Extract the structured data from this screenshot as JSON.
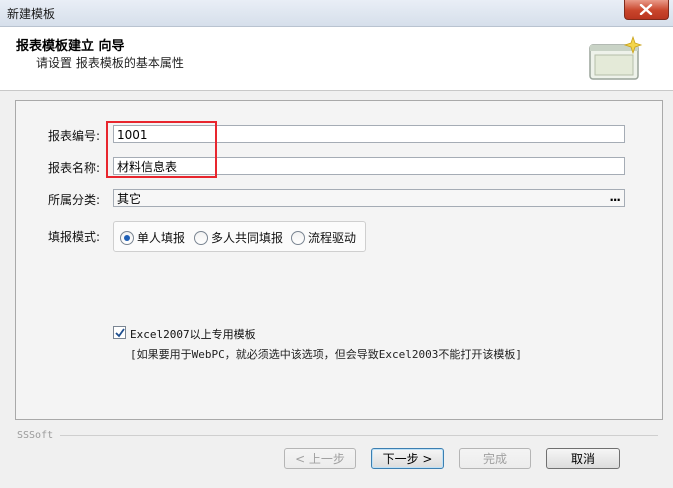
{
  "window": {
    "title": "新建模板"
  },
  "header": {
    "title": "报表模板建立 向导",
    "subtitle": "请设置 报表模板的基本属性"
  },
  "form": {
    "code": {
      "label": "报表编号:",
      "value": "1001"
    },
    "name": {
      "label": "报表名称:",
      "value": "材料信息表"
    },
    "category": {
      "label": "所属分类:",
      "value": "其它",
      "browse": "..."
    },
    "mode": {
      "label": "填报模式:",
      "options": [
        {
          "label": "单人填报",
          "selected": true
        },
        {
          "label": "多人共同填报",
          "selected": false
        },
        {
          "label": "流程驱动",
          "selected": false
        }
      ]
    },
    "excel_option": {
      "checked": true,
      "label": "Excel2007以上专用模板",
      "note": "[如果要用于WebPC，就必须选中该选项，但会导致Excel2003不能打开该模板]"
    }
  },
  "footer": {
    "brand": "SSSoft"
  },
  "buttons": {
    "prev": "< 上一步",
    "next": "下一步 >",
    "finish": "完成",
    "cancel": "取消"
  },
  "colors": {
    "highlight": "#e8262e",
    "close": "#c9452b"
  }
}
